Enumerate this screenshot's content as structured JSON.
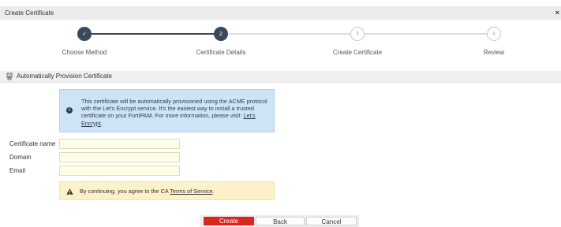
{
  "dialog": {
    "title": "Create Certificate",
    "close_symbol": "×"
  },
  "stepper": {
    "steps": [
      {
        "number": "✓",
        "label": "Choose Method",
        "status": "done"
      },
      {
        "number": "2",
        "label": "Certificate Details",
        "status": "active"
      },
      {
        "number": "3",
        "label": "Create Certificate",
        "status": "pending"
      },
      {
        "number": "4",
        "label": "Review",
        "status": "pending"
      }
    ]
  },
  "section": {
    "icon": "certificate-icon",
    "title": "Automatically Provision Certificate"
  },
  "info": {
    "icon": "info-icon",
    "text": "This certificate will be automatically provisioned using the ACME protocol with the Let's Encrypt service. It's the easiest way to install a trusted certificate on your FortiPAM. For more information, please visit: ",
    "link": "Let's Encrypt",
    "suffix": "."
  },
  "form": {
    "certificate_name": {
      "label": "Certificate name",
      "value": ""
    },
    "domain": {
      "label": "Domain",
      "value": ""
    },
    "email": {
      "label": "Email",
      "value": ""
    }
  },
  "warning": {
    "icon": "warning-icon",
    "text_before": "By continuing, you agree to the CA ",
    "link": "Terms of Service",
    "text_after": "."
  },
  "buttons": {
    "create": "Create",
    "back": "Back",
    "cancel": "Cancel"
  },
  "colors": {
    "primary": "#d9281e",
    "step_active": "#3a4a5c",
    "info_bg": "#cfe3f7",
    "warning_bg": "#fdf1c9",
    "input_bg": "#fffde8"
  }
}
